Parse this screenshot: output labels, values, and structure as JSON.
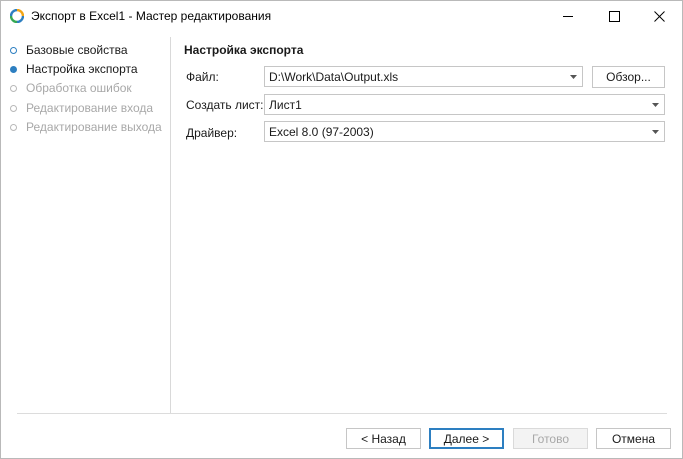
{
  "window": {
    "title": "Экспорт в Excel1 - Мастер редактирования"
  },
  "nav": {
    "items": [
      {
        "label": "Базовые свойства",
        "state": "done"
      },
      {
        "label": "Настройка экспорта",
        "state": "active"
      },
      {
        "label": "Обработка ошибок",
        "state": "pending"
      },
      {
        "label": "Редактирование входа",
        "state": "pending"
      },
      {
        "label": "Редактирование выхода",
        "state": "pending"
      }
    ]
  },
  "main": {
    "section_title": "Настройка экспорта",
    "file": {
      "label": "Файл:",
      "value": "D:\\Work\\Data\\Output.xls"
    },
    "browse_label": "Обзор...",
    "sheet": {
      "label": "Создать лист:",
      "value": "Лист1"
    },
    "driver": {
      "label": "Драйвер:",
      "value": "Excel 8.0 (97-2003)"
    }
  },
  "footer": {
    "back_label": "< Назад",
    "next_label": "Далее >",
    "finish_label": "Готово",
    "cancel_label": "Отмена"
  },
  "colors": {
    "accent": "#2d7fc1",
    "disabled_text": "#a8a8a8"
  }
}
